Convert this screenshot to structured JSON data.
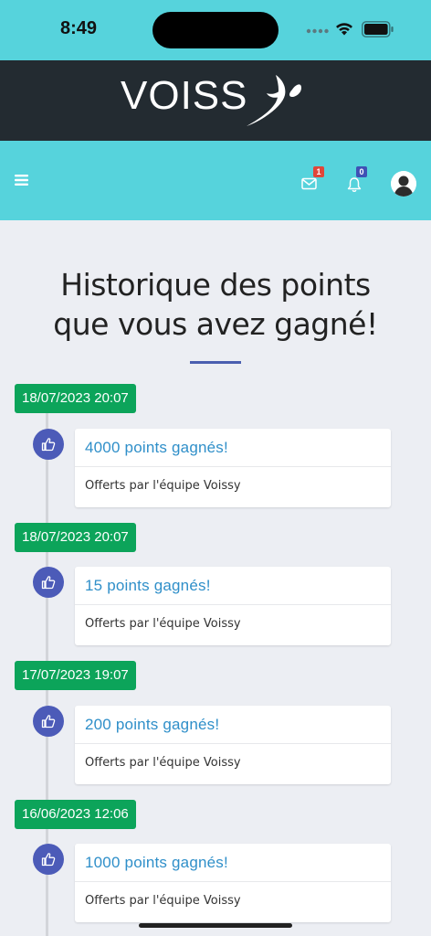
{
  "status_bar": {
    "time": "8:49",
    "icons": [
      "signal-dots-icon",
      "wifi-icon",
      "battery-icon"
    ]
  },
  "brand": {
    "logo_text": "VOISS",
    "logo_alt": "Voissy"
  },
  "nav": {
    "menu_icon": "hamburger-menu-icon",
    "mail_badge": "1",
    "notification_badge": "0",
    "mail_badge_color": "#e0463a",
    "notification_badge_color": "#3f51b5"
  },
  "page": {
    "title_line1": "Historique des points",
    "title_line2": "que vous avez gagné!"
  },
  "colors": {
    "header_cyan": "#56d3dc",
    "brand_dark": "#232b31",
    "date_green": "#0ca45a",
    "thumb_blue": "#4c5bb8",
    "points_blue": "#2f8fc9"
  },
  "timeline": [
    {
      "date": "18/07/2023 20:07",
      "points": "4000 points gagnés!",
      "source": "Offerts par l'équipe Voissy"
    },
    {
      "date": "18/07/2023 20:07",
      "points": "15 points gagnés!",
      "source": "Offerts par l'équipe Voissy"
    },
    {
      "date": "17/07/2023 19:07",
      "points": "200 points gagnés!",
      "source": "Offerts par l'équipe Voissy"
    },
    {
      "date": "16/06/2023 12:06",
      "points": "1000 points gagnés!",
      "source": "Offerts par l'équipe Voissy"
    }
  ]
}
